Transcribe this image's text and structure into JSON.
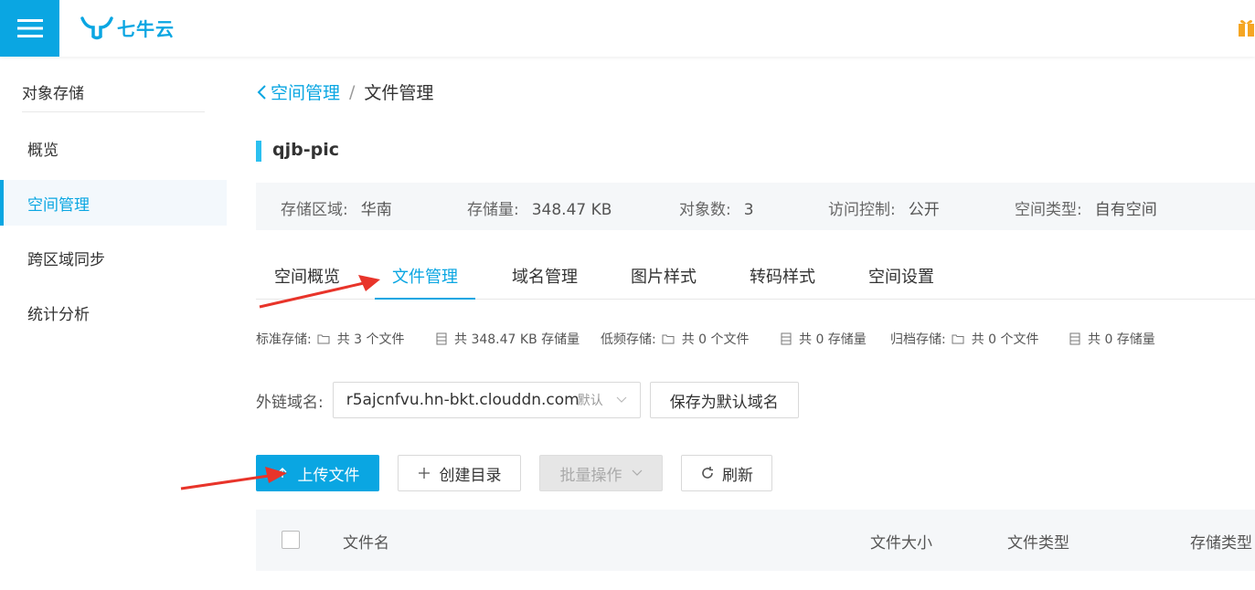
{
  "header": {
    "logo_text": "七牛云"
  },
  "sidebar": {
    "title": "对象存储",
    "items": [
      {
        "label": "概览"
      },
      {
        "label": "空间管理"
      },
      {
        "label": "跨区域同步"
      },
      {
        "label": "统计分析"
      }
    ]
  },
  "breadcrumb": {
    "parent": "空间管理",
    "separator": "/",
    "current": "文件管理"
  },
  "bucket": {
    "name": "qjb-pic"
  },
  "info": {
    "region_label": "存储区域:",
    "region_value": "华南",
    "size_label": "存储量:",
    "size_value": "348.47 KB",
    "objects_label": "对象数:",
    "objects_value": "3",
    "access_label": "访问控制:",
    "access_value": "公开",
    "type_label": "空间类型:",
    "type_value": "自有空间"
  },
  "tabs": [
    {
      "label": "空间概览"
    },
    {
      "label": "文件管理"
    },
    {
      "label": "域名管理"
    },
    {
      "label": "图片样式"
    },
    {
      "label": "转码样式"
    },
    {
      "label": "空间设置"
    }
  ],
  "stats": {
    "standard_label": "标准存储:",
    "standard_files": "共 3 个文件",
    "standard_size": "共 348.47 KB 存储量",
    "low_label": "低频存储:",
    "low_files": "共 0 个文件",
    "low_size": "共 0 存储量",
    "archive_label": "归档存储:",
    "archive_files": "共 0 个文件",
    "archive_size": "共 0 存储量"
  },
  "domain": {
    "label": "外链域名:",
    "value": "r5ajcnfvu.hn-bkt.clouddn.com",
    "tag": "默认",
    "save_button": "保存为默认域名"
  },
  "actions": {
    "upload": "上传文件",
    "create_dir": "创建目录",
    "batch": "批量操作",
    "refresh": "刷新"
  },
  "table": {
    "columns": [
      "文件名",
      "文件大小",
      "文件类型",
      "存储类型"
    ]
  },
  "colors": {
    "accent": "#0aa6e2",
    "annotation_arrow": "#e8342a"
  }
}
